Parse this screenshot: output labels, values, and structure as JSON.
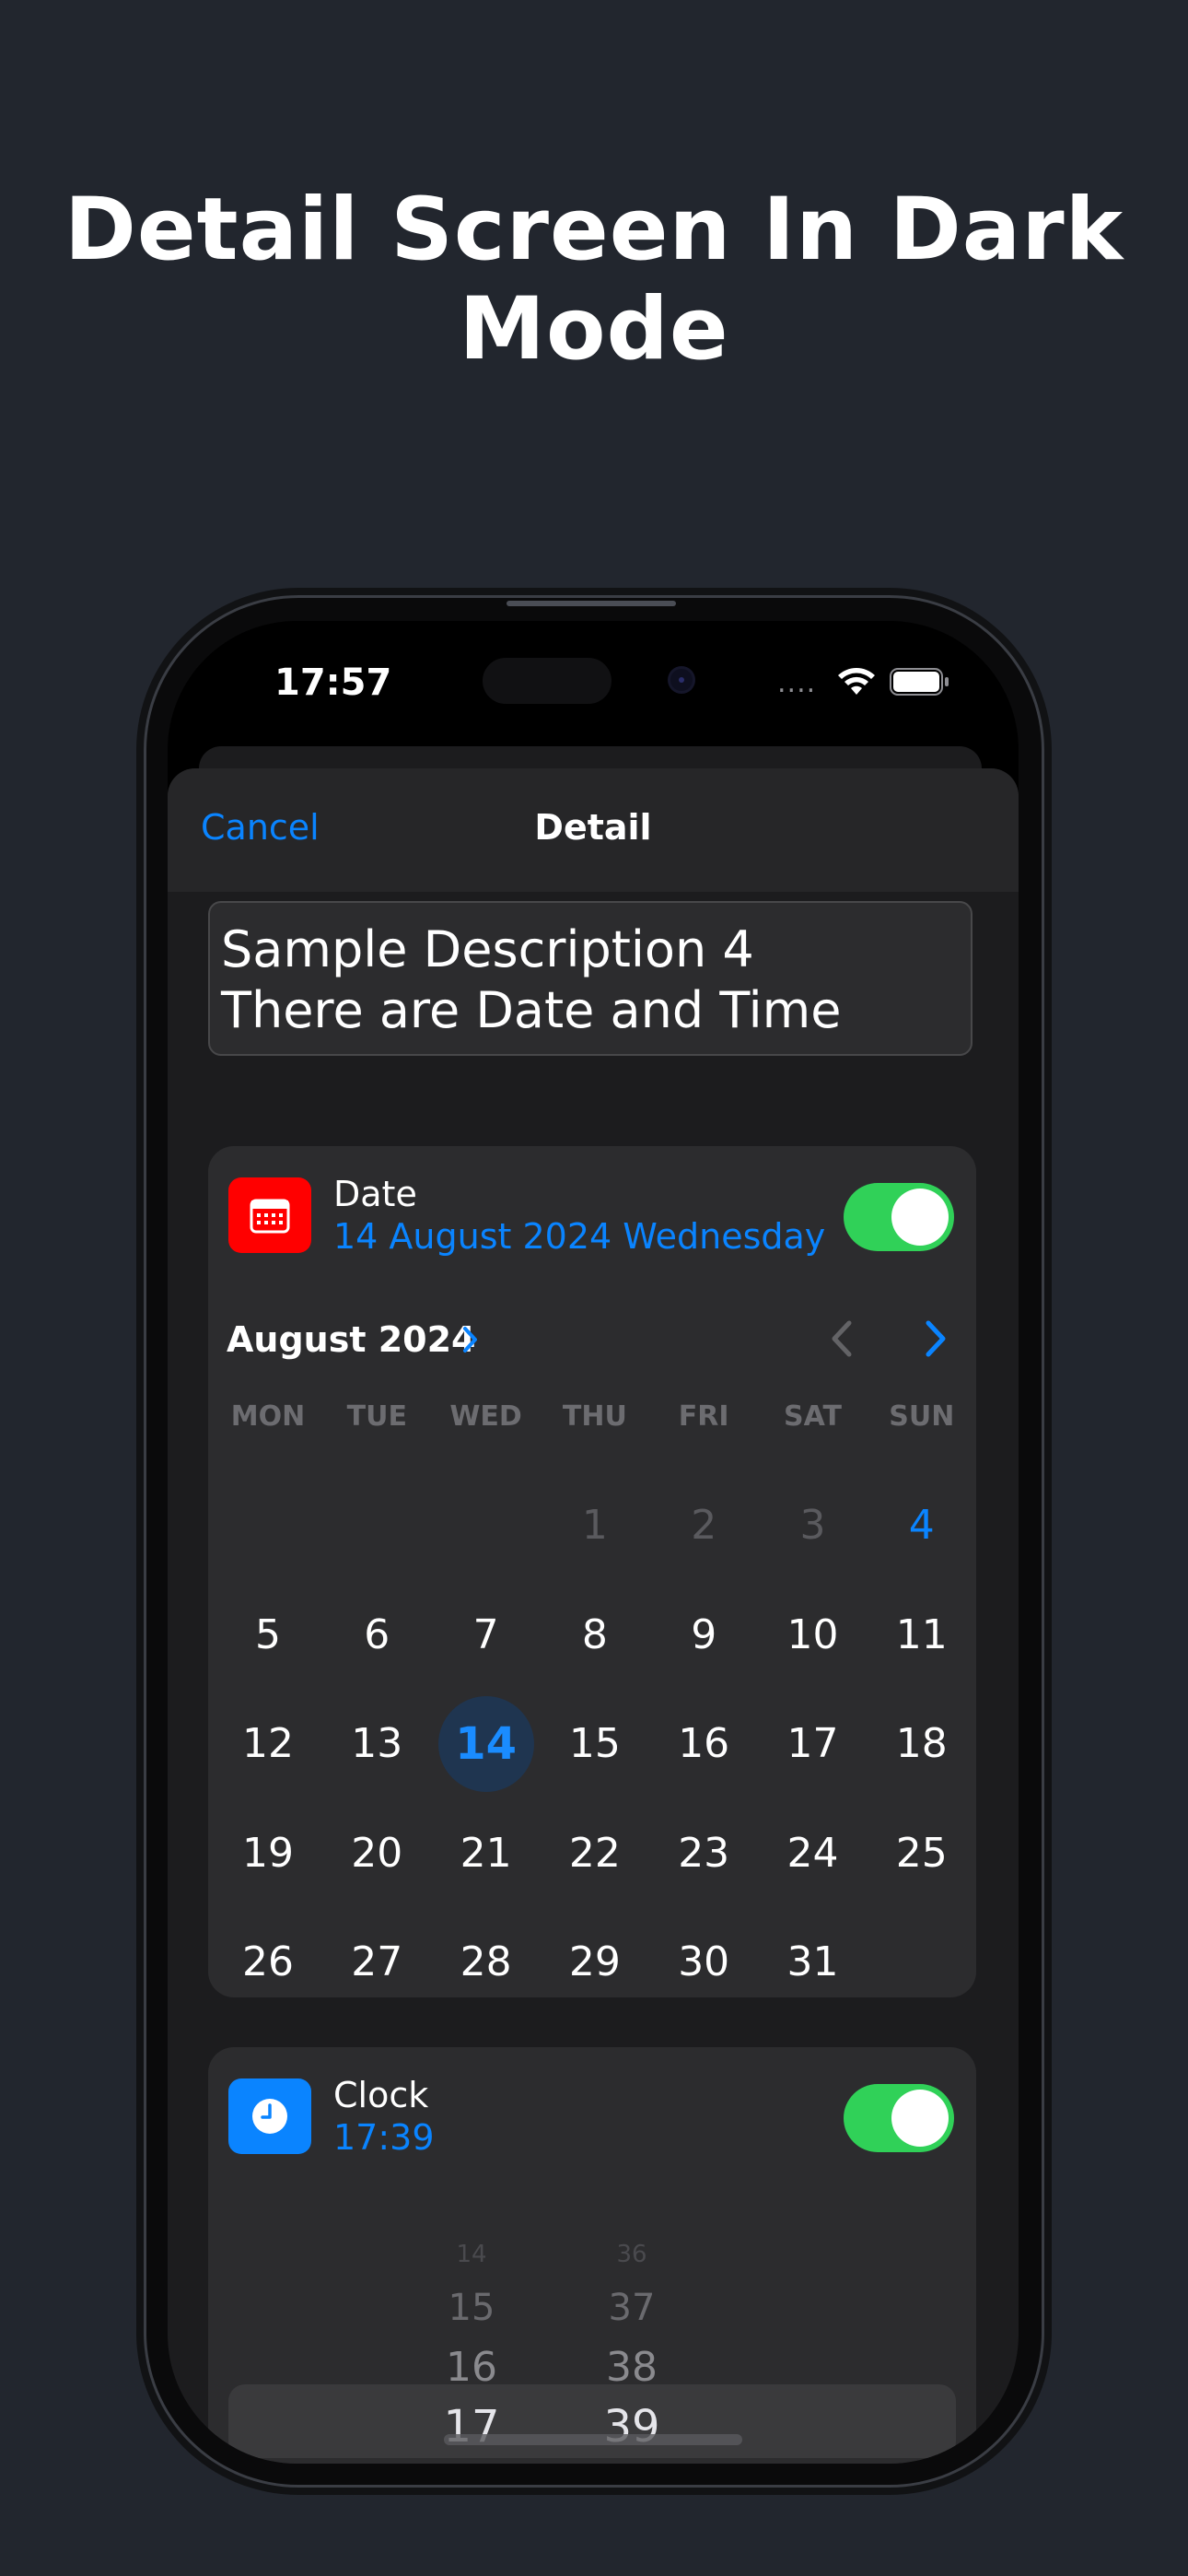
{
  "headline": {
    "line1": "Detail Screen In Dark",
    "line2": "Mode"
  },
  "status_bar": {
    "time": "17:57",
    "signal": "....",
    "wifi": "wifi-icon",
    "battery": "battery-icon"
  },
  "nav": {
    "cancel_label": "Cancel",
    "title": "Detail"
  },
  "description": {
    "line1": "Sample Description 4",
    "line2": "There are Date and Time"
  },
  "date_row": {
    "title": "Date",
    "value": "14 August 2024 Wednesday",
    "icon": "calendar-icon",
    "icon_color": "#ff0000",
    "toggle_on": true
  },
  "calendar": {
    "month_label": "August 2024",
    "weekdays": [
      "MON",
      "TUE",
      "WED",
      "THU",
      "FRI",
      "SAT",
      "SUN"
    ],
    "weeks": [
      [
        "",
        "",
        "",
        "1",
        "2",
        "3",
        "4"
      ],
      [
        "5",
        "6",
        "7",
        "8",
        "9",
        "10",
        "11"
      ],
      [
        "12",
        "13",
        "14",
        "15",
        "16",
        "17",
        "18"
      ],
      [
        "19",
        "20",
        "21",
        "22",
        "23",
        "24",
        "25"
      ],
      [
        "26",
        "27",
        "28",
        "29",
        "30",
        "31",
        ""
      ]
    ],
    "selected_day": "14",
    "accent_color": "#0a84ff"
  },
  "clock_row": {
    "title": "Clock",
    "value": "17:39",
    "icon": "clock-icon",
    "icon_color": "#0a84ff",
    "toggle_on": true
  },
  "time_picker": {
    "hours": [
      "14",
      "15",
      "16",
      "17"
    ],
    "minutes": [
      "36",
      "37",
      "38",
      "39"
    ],
    "selected_hour": "17",
    "selected_minute": "39"
  },
  "colors": {
    "background": "#22262e",
    "toggle_green": "#30d158",
    "accent": "#0a84ff"
  }
}
